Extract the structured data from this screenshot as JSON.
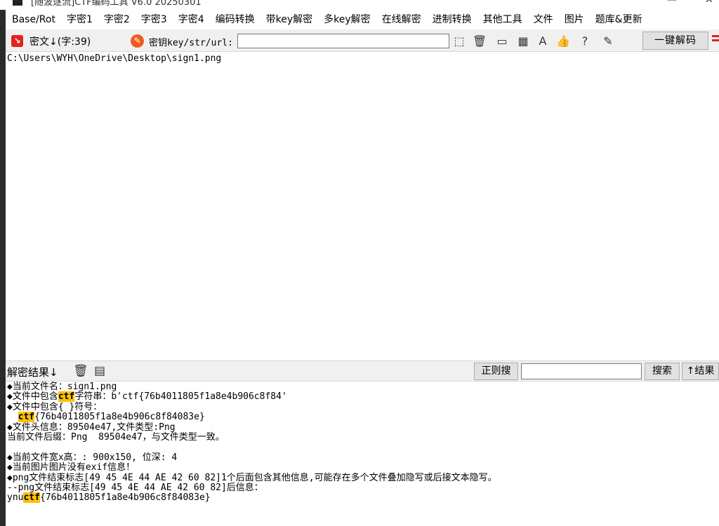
{
  "window": {
    "title": "[随波逐流]CTF编码工具 V6.0 20250301",
    "minimize": "—",
    "close": "✕"
  },
  "menu": [
    "Base/Rot",
    "字密1",
    "字密2",
    "字密3",
    "字密4",
    "编码转换",
    "带key解密",
    "多key解密",
    "在线解密",
    "进制转换",
    "其他工具",
    "文件",
    "图片",
    "题库&更新"
  ],
  "toolbar": {
    "cipher_label": "密文↓(字:39)",
    "key_label": "密钥key/str/url:",
    "key_value": "",
    "decode_button": "一键解码",
    "icons": [
      "cursor-select-icon",
      "trash-icon",
      "terminal-icon",
      "calculator-icon",
      "font-icon",
      "thumbs-up-icon",
      "help-icon",
      "edit-icon"
    ]
  },
  "input": {
    "text": "C:\\Users\\WYH\\OneDrive\\Desktop\\sign1.png"
  },
  "resultbar": {
    "label": "解密结果↓",
    "regex_button": "正则搜",
    "search_value": "",
    "search_button": "搜索",
    "result_button": "↑结果"
  },
  "output": {
    "lines": [
      {
        "pre": "◆当前文件名：sign1.png",
        "hl": "",
        "post": ""
      },
      {
        "pre": "◆文件中包含",
        "hl": "ctf",
        "post": "字符串：b'ctf{76b4011805f1a8e4b906c8f84'"
      },
      {
        "pre": "◆文件中包含{ }符号：",
        "hl": "",
        "post": ""
      },
      {
        "pre": "  ",
        "hl": "ctf",
        "post": "{76b4011805f1a8e4b906c8f84083e}"
      },
      {
        "pre": "◆文件头信息：89504e47,文件类型:Png",
        "hl": "",
        "post": ""
      },
      {
        "pre": "当前文件后缀：Png  89504e47，与文件类型一致。",
        "hl": "",
        "post": ""
      },
      {
        "pre": "",
        "hl": "",
        "post": ""
      },
      {
        "pre": "◆当前文件宽x高：: 900x150, 位深: 4",
        "hl": "",
        "post": ""
      },
      {
        "pre": "◆当前图片图片没有exif信息！",
        "hl": "",
        "post": ""
      },
      {
        "pre": "◆png文件结束标志[49 45 4E 44 AE 42 60 82]1个后面包含其他信息,可能存在多个文件叠加隐写或后接文本隐写。",
        "hl": "",
        "post": ""
      },
      {
        "pre": "--png文件结束标志[49 45 4E 44 AE 42 60 82]后信息：",
        "hl": "",
        "post": ""
      },
      {
        "pre": "ynu",
        "hl": "ctf",
        "post": "{76b4011805f1a8e4b906c8f84083e}"
      }
    ]
  }
}
